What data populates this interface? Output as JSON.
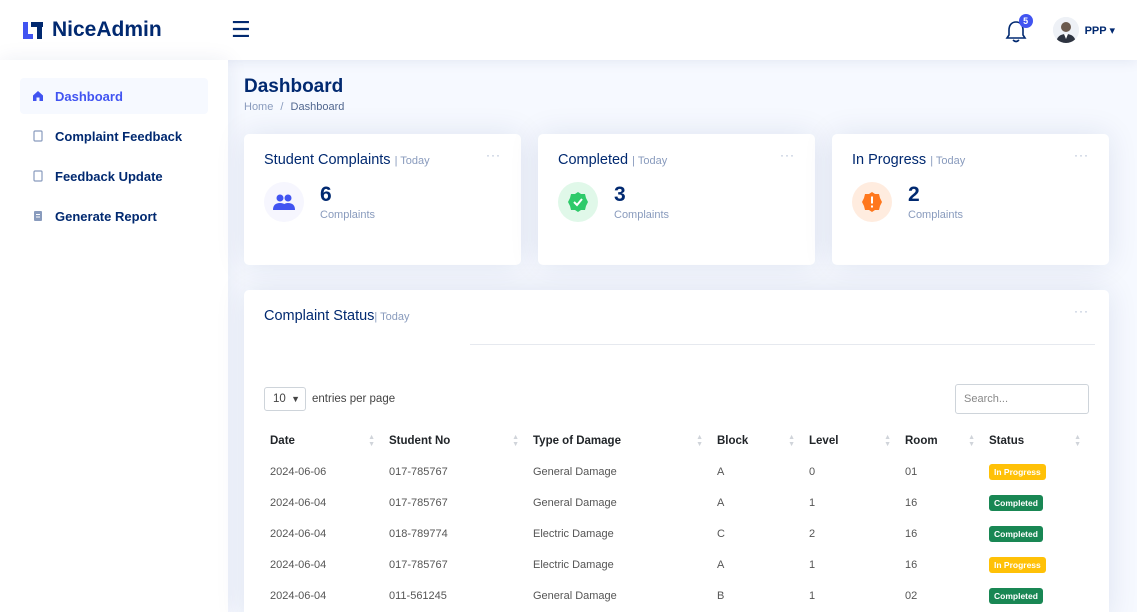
{
  "app": {
    "name": "NiceAdmin"
  },
  "header": {
    "notification_count": "5",
    "user_name": "PPP",
    "colors": {
      "accent": "#4154f1",
      "navy": "#012970"
    }
  },
  "sidebar": {
    "items": [
      {
        "label": "Dashboard",
        "icon": "home-icon",
        "active": true
      },
      {
        "label": "Complaint Feedback",
        "icon": "document-icon",
        "active": false
      },
      {
        "label": "Feedback Update",
        "icon": "document-icon",
        "active": false
      },
      {
        "label": "Generate Report",
        "icon": "report-icon",
        "active": false
      }
    ]
  },
  "page": {
    "title": "Dashboard",
    "breadcrumb": {
      "home": "Home",
      "separator": "/",
      "current": "Dashboard"
    }
  },
  "cards": [
    {
      "title": "Student Complaints",
      "period": "| Today",
      "count": "6",
      "unit": "Complaints",
      "icon": "people-icon",
      "icon_bg": "#f6f6fe",
      "icon_color": "#4154f1"
    },
    {
      "title": "Completed",
      "period": "| Today",
      "count": "3",
      "unit": "Complaints",
      "icon": "check-badge-icon",
      "icon_bg": "#e0f8e9",
      "icon_color": "#2eca6a"
    },
    {
      "title": "In Progress",
      "period": "| Today",
      "count": "2",
      "unit": "Complaints",
      "icon": "alert-icon",
      "icon_bg": "#ffecdf",
      "icon_color": "#ff771d"
    }
  ],
  "status": {
    "title": "Complaint Status",
    "period": "| Today",
    "entries_value": "10",
    "entries_label": "entries per page",
    "search_placeholder": "Search...",
    "columns": [
      "Date",
      "Student No",
      "Type of Damage",
      "Block",
      "Level",
      "Room",
      "Status"
    ],
    "rows": [
      [
        "2024-06-06",
        "017-785767",
        "General Damage",
        "A",
        "0",
        "01",
        "In Progress"
      ],
      [
        "2024-06-04",
        "017-785767",
        "General Damage",
        "A",
        "1",
        "16",
        "Completed"
      ],
      [
        "2024-06-04",
        "018-789774",
        "Electric Damage",
        "C",
        "2",
        "16",
        "Completed"
      ],
      [
        "2024-06-04",
        "017-785767",
        "Electric Damage",
        "A",
        "1",
        "16",
        "In Progress"
      ],
      [
        "2024-06-04",
        "011-561245",
        "General Damage",
        "B",
        "1",
        "02",
        "Completed"
      ]
    ]
  }
}
